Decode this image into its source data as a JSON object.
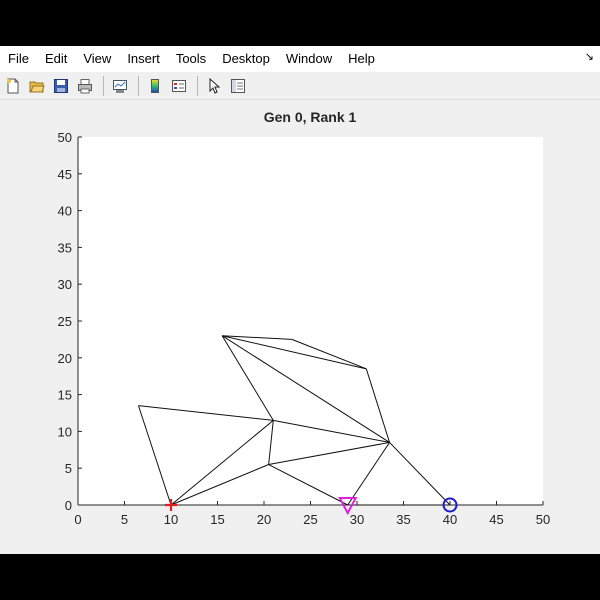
{
  "menubar": {
    "items": [
      "File",
      "Edit",
      "View",
      "Insert",
      "Tools",
      "Desktop",
      "Window",
      "Help"
    ],
    "dock_arrow": "↘"
  },
  "toolbar": {
    "icons": [
      "new-figure-icon",
      "open-file-icon",
      "save-icon",
      "print-icon",
      "link-plot-icon",
      "colorbar-icon",
      "legend-icon",
      "pointer-icon",
      "property-inspector-icon"
    ]
  },
  "chart_data": {
    "type": "line",
    "title": "Gen 0, Rank 1",
    "xlabel": "",
    "ylabel": "",
    "xlim": [
      0,
      50
    ],
    "ylim": [
      0,
      50
    ],
    "xticks": [
      0,
      5,
      10,
      15,
      20,
      25,
      30,
      35,
      40,
      45,
      50
    ],
    "yticks": [
      0,
      5,
      10,
      15,
      20,
      25,
      30,
      35,
      40,
      45,
      50
    ],
    "grid": false,
    "nodes": [
      {
        "id": "A",
        "x": 10,
        "y": 0
      },
      {
        "id": "B",
        "x": 29,
        "y": 0
      },
      {
        "id": "C",
        "x": 40,
        "y": 0
      },
      {
        "id": "D",
        "x": 6.5,
        "y": 13.5
      },
      {
        "id": "E",
        "x": 15.5,
        "y": 23
      },
      {
        "id": "F",
        "x": 23,
        "y": 22.5
      },
      {
        "id": "G",
        "x": 31,
        "y": 18.5
      },
      {
        "id": "H",
        "x": 21,
        "y": 11.5
      },
      {
        "id": "I",
        "x": 20.5,
        "y": 5.5
      },
      {
        "id": "J",
        "x": 33.5,
        "y": 8.5
      }
    ],
    "members": [
      [
        "A",
        "D"
      ],
      [
        "D",
        "H"
      ],
      [
        "A",
        "H"
      ],
      [
        "A",
        "I"
      ],
      [
        "H",
        "I"
      ],
      [
        "H",
        "E"
      ],
      [
        "E",
        "F"
      ],
      [
        "F",
        "G"
      ],
      [
        "E",
        "G"
      ],
      [
        "G",
        "J"
      ],
      [
        "E",
        "J"
      ],
      [
        "H",
        "J"
      ],
      [
        "I",
        "J"
      ],
      [
        "I",
        "B"
      ],
      [
        "B",
        "J"
      ],
      [
        "J",
        "C"
      ],
      [
        "B",
        "C"
      ]
    ],
    "markers": [
      {
        "node": "A",
        "shape": "plus",
        "color": "#e02020"
      },
      {
        "node": "B",
        "shape": "triangle-down",
        "color": "#e020e0"
      },
      {
        "node": "C",
        "shape": "circle",
        "color": "#1a1ad0"
      }
    ]
  }
}
